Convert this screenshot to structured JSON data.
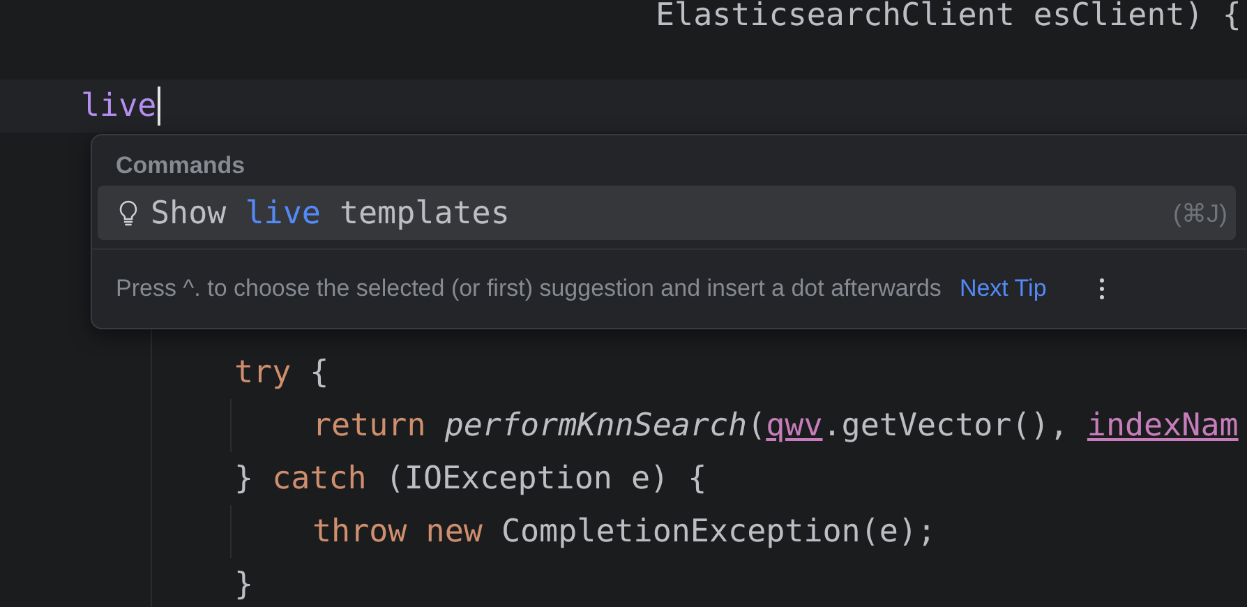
{
  "code_top": "ElasticsearchClient esClient) {",
  "typed_line": {
    "text": "live",
    "caret": true
  },
  "popup": {
    "section": "Commands",
    "items": [
      {
        "kind": "bulb",
        "selected": true,
        "parts": [
          {
            "text": "Show ",
            "kind": "plain"
          },
          {
            "text": "live",
            "kind": "match"
          },
          {
            "text": " templates",
            "kind": "plain"
          }
        ],
        "shortcut": "(⌘J)"
      }
    ],
    "tip": "Press ^. to choose the selected (or first) suggestion and insert a dot afterwards",
    "tip_link": "Next Tip"
  },
  "code_lines": [
    {
      "tokens": [
        {
          "text": "try",
          "kind": "keyword"
        },
        {
          "text": " {",
          "kind": "plain"
        }
      ],
      "children": [
        {
          "tokens": [
            {
              "text": "return ",
              "kind": "keyword"
            },
            {
              "text": "performKnnSearch",
              "kind": "method"
            },
            {
              "text": "(",
              "kind": "plain"
            },
            {
              "text": "qwv",
              "kind": "field"
            },
            {
              "text": ".getVector(), ",
              "kind": "plain"
            },
            {
              "text": "indexNam",
              "kind": "field"
            }
          ]
        }
      ]
    },
    {
      "tokens": [
        {
          "text": "} ",
          "kind": "plain"
        },
        {
          "text": "catch",
          "kind": "keyword"
        },
        {
          "text": " (IOException e) {",
          "kind": "plain"
        }
      ],
      "children": [
        {
          "tokens": [
            {
              "text": "throw new ",
              "kind": "keyword"
            },
            {
              "text": "CompletionException(e);",
              "kind": "plain"
            }
          ]
        }
      ]
    },
    {
      "tokens": [
        {
          "text": "}",
          "kind": "plain"
        }
      ]
    }
  ]
}
